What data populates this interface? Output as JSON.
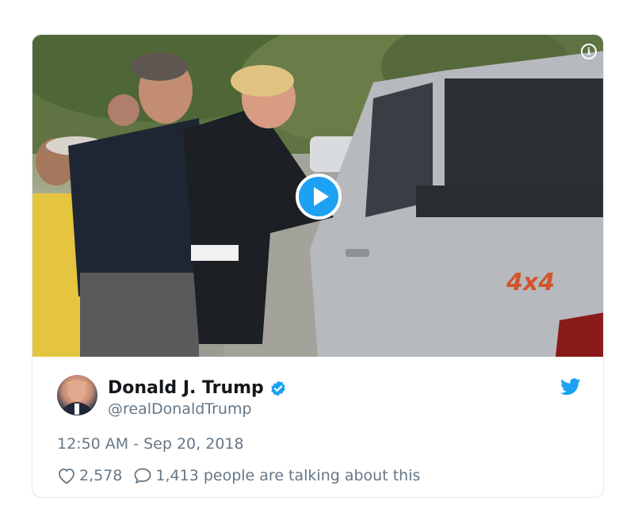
{
  "media": {
    "info_icon_glyph": "i",
    "play_icon": "play-icon"
  },
  "tweet": {
    "display_name": "Donald J. Trump",
    "handle": "@realDonaldTrump",
    "timestamp": "12:50 AM - Sep 20, 2018",
    "likes": "2,578",
    "talking": "1,413 people are talking about this",
    "verified_icon": "verified-badge-icon",
    "brand_icon": "twitter-bird-icon"
  },
  "colors": {
    "twitter_blue": "#1da1f2",
    "text_primary": "#14171a",
    "text_secondary": "#657786",
    "border": "#e1e8ed"
  }
}
